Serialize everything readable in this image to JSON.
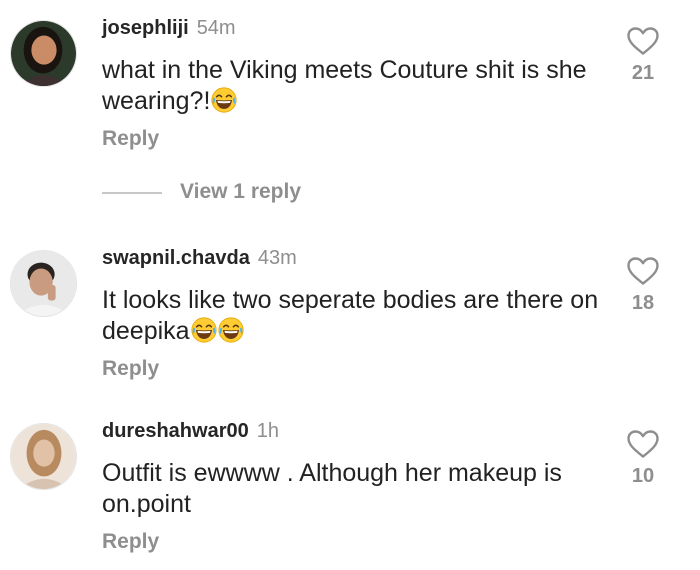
{
  "comments": [
    {
      "username": "josephliji",
      "time": "54m",
      "text": "what in the Viking meets Couture shit is she wearing?!",
      "emoji": "face-with-tears-of-joy",
      "likes": "21",
      "reply_label": "Reply",
      "view_replies_label": "View 1 reply"
    },
    {
      "username": "swapnil.chavda",
      "time": "43m",
      "text": "It looks like two seperate bodies are there on deepika",
      "emoji": "face-with-tears-of-joy x2",
      "likes": "18",
      "reply_label": "Reply"
    },
    {
      "username": "dureshahwar00",
      "time": "1h",
      "text": "Outfit is ewwww . Although her makeup is on.point",
      "likes": "10",
      "reply_label": "Reply"
    }
  ],
  "icons": {
    "like": "heart-outline-icon",
    "emoji": "face-with-tears-of-joy"
  },
  "colors": {
    "secondary_text": "#8e8e8e",
    "username": "#262626"
  }
}
